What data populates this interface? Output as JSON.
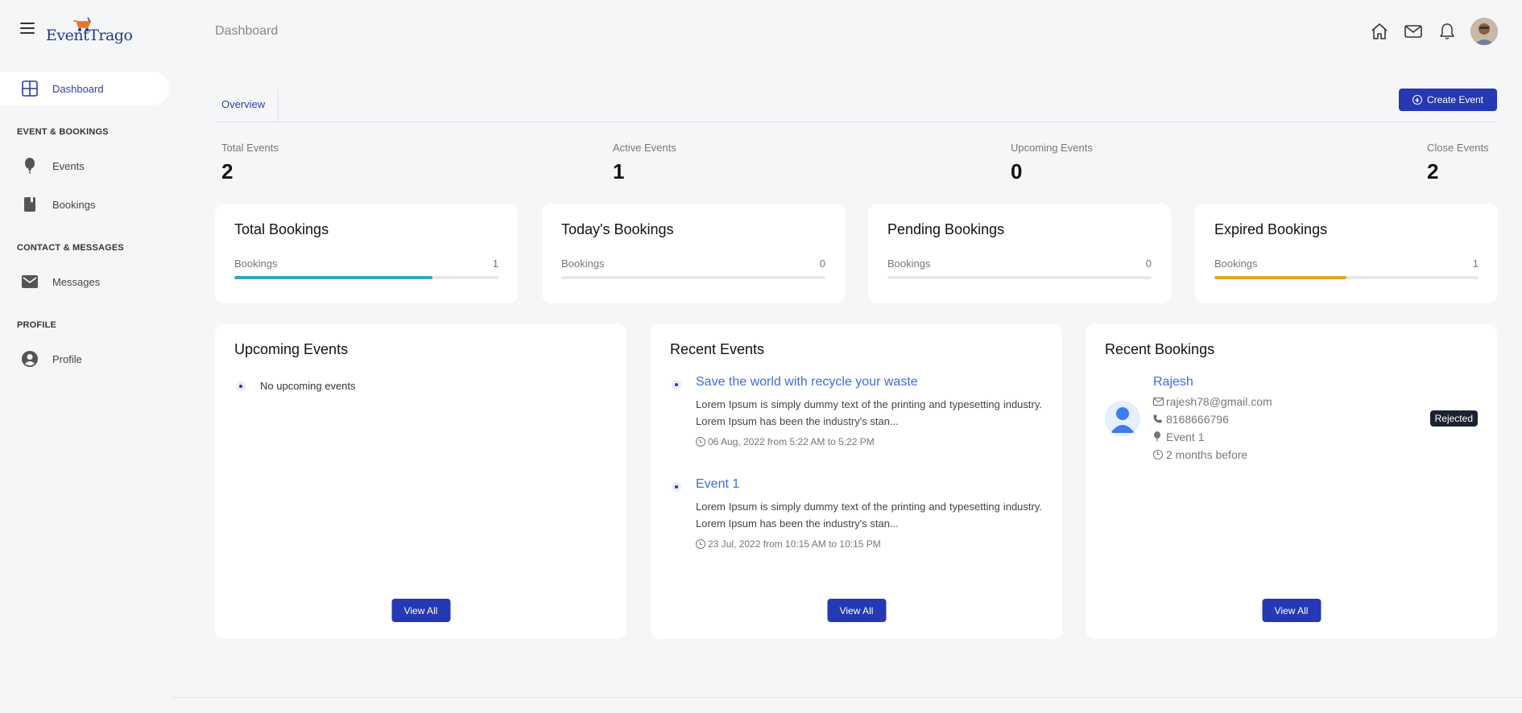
{
  "app": {
    "logo_text": "EventTrago",
    "page_title": "Dashboard"
  },
  "sidebar": {
    "dashboard": "Dashboard",
    "sections": {
      "events_bookings": "EVENT & BOOKINGS",
      "contact_messages": "CONTACT & MESSAGES",
      "profile": "PROFILE"
    },
    "items": {
      "events": "Events",
      "bookings": "Bookings",
      "messages": "Messages",
      "profile": "Profile"
    }
  },
  "header": {
    "icons": [
      "home-icon",
      "mail-icon",
      "bell-icon",
      "avatar"
    ]
  },
  "tabs": {
    "overview": "Overview"
  },
  "actions": {
    "create_event": "Create Event",
    "view_all": "View All"
  },
  "stats": {
    "total": {
      "label": "Total Events",
      "value": "2"
    },
    "active": {
      "label": "Active Events",
      "value": "1"
    },
    "upcoming": {
      "label": "Upcoming Events",
      "value": "0"
    },
    "close": {
      "label": "Close Events",
      "value": "2"
    }
  },
  "booking_cards": {
    "total": {
      "title": "Total Bookings",
      "label": "Bookings",
      "count": "1",
      "progress": 0.75,
      "color": "#32a8bd"
    },
    "today": {
      "title": "Today's Bookings",
      "label": "Bookings",
      "count": "0",
      "progress": 0,
      "color": "#32a8bd"
    },
    "pending": {
      "title": "Pending Bookings",
      "label": "Bookings",
      "count": "0",
      "progress": 0,
      "color": "#32a8bd"
    },
    "expired": {
      "title": "Expired Bookings",
      "label": "Bookings",
      "count": "1",
      "progress": 0.5,
      "color": "#e0a81e"
    }
  },
  "upcoming_events": {
    "title": "Upcoming Events",
    "empty": "No upcoming events"
  },
  "recent_events": {
    "title": "Recent Events",
    "items": [
      {
        "title": "Save the world with recycle your waste",
        "desc": "Lorem Ipsum is simply dummy text of the printing and typesetting industry. Lorem Ipsum has been the industry's stan...",
        "date": "06 Aug, 2022 from 5:22 AM to 5:22 PM"
      },
      {
        "title": "Event 1",
        "desc": "Lorem Ipsum is simply dummy text of the printing and typesetting industry. Lorem Ipsum has been the industry's stan...",
        "date": "23 Jul, 2022 from 10:15 AM to 10:15 PM"
      }
    ]
  },
  "recent_bookings": {
    "title": "Recent Bookings",
    "items": [
      {
        "name": "Rajesh",
        "email": "rajesh78@gmail.com",
        "phone": "8168666796",
        "event": "Event 1",
        "time": "2 months before",
        "status": "Rejected"
      }
    ]
  },
  "colors": {
    "primary": "#2439b3",
    "link": "#3b6ce0",
    "teal": "#32a8bd",
    "amber": "#e0a81e"
  }
}
